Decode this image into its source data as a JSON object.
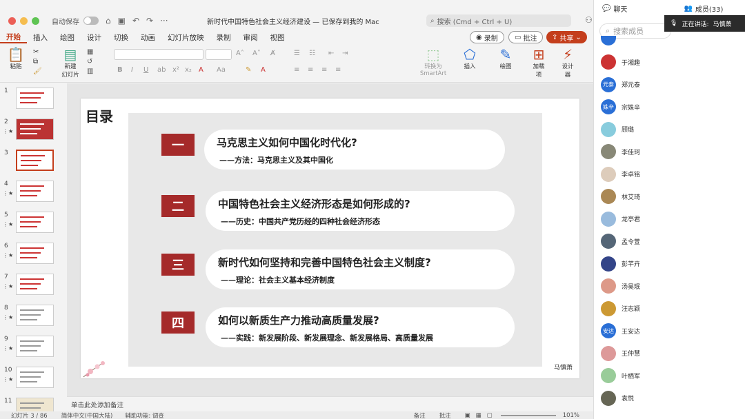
{
  "titlebar": {
    "autosave_label": "自动保存",
    "doc_title": "新时代中国特色社会主义经济建设 — 已保存到我的 Mac",
    "search_placeholder": "搜索 (Cmd + Ctrl + U)"
  },
  "menu": [
    "开始",
    "插入",
    "绘图",
    "设计",
    "切换",
    "动画",
    "幻灯片放映",
    "录制",
    "审阅",
    "视图"
  ],
  "actions": {
    "record": "录制",
    "comment": "批注",
    "share": "共享"
  },
  "ribbon": {
    "paste": "粘贴",
    "new_slide": "新建\n幻灯片",
    "smartart": "转换为\nSmartArt",
    "insert": "插入",
    "draw": "绘图",
    "addins": "加载\n项",
    "designer": "设计\n器"
  },
  "thumbnails": [
    "1",
    "2",
    "3",
    "4",
    "5",
    "6",
    "7",
    "8",
    "9",
    "10",
    "11"
  ],
  "slide": {
    "title": "目录",
    "items": [
      {
        "num": "一",
        "question": "马克思主义如何中国化时代化?",
        "sub": "——方法：马克思主义及其中国化"
      },
      {
        "num": "二",
        "question": "中国特色社会主义经济形态是如何形成的?",
        "sub": "——历史：中国共产党历经的四种社会经济形态"
      },
      {
        "num": "三",
        "question": "新时代如何坚持和完善中国特色社会主义制度?",
        "sub": "——理论：社会主义基本经济制度"
      },
      {
        "num": "四",
        "question": "如何以新质生产力推动高质量发展?",
        "sub": "——实践：新发展阶段、新发展理念、新发展格局、高质量发展"
      }
    ],
    "signature": "马慎萧"
  },
  "notes_placeholder": "单击此处添加备注",
  "status": {
    "slide_info": "幻灯片 3 / 86",
    "language": "简体中文(中国大陆)",
    "accessibility": "辅助功能: 调查",
    "notes": "备注",
    "comments": "批注",
    "zoom": "101%"
  },
  "meeting": {
    "chat_tab": "聊天",
    "members_tab": "成员(33)",
    "speaking_label": "正在讲话:",
    "speaker": "马慎萧",
    "search_placeholder": "搜索成员",
    "members": [
      {
        "name": "于湘趣",
        "avatar": "",
        "color": "#c33"
      },
      {
        "name": "郑元泰",
        "avatar": "元泰",
        "color": "#2a6fd6"
      },
      {
        "name": "宗姝辛",
        "avatar": "姝辛",
        "color": "#2a6fd6"
      },
      {
        "name": "顾璐",
        "avatar": "",
        "color": "#8cd"
      },
      {
        "name": "李佳珂",
        "avatar": "",
        "color": "#887"
      },
      {
        "name": "李卓铭",
        "avatar": "",
        "color": "#dcb"
      },
      {
        "name": "林艾琦",
        "avatar": "",
        "color": "#a85"
      },
      {
        "name": "龙亭君",
        "avatar": "",
        "color": "#9bd"
      },
      {
        "name": "孟令萱",
        "avatar": "",
        "color": "#567"
      },
      {
        "name": "彭芊卉",
        "avatar": "",
        "color": "#348"
      },
      {
        "name": "汤昊珉",
        "avatar": "",
        "color": "#d98"
      },
      {
        "name": "汪志颖",
        "avatar": "",
        "color": "#c93"
      },
      {
        "name": "王安达",
        "avatar": "安达",
        "color": "#2a6fd6"
      },
      {
        "name": "王仲慧",
        "avatar": "",
        "color": "#d99"
      },
      {
        "name": "叶栖军",
        "avatar": "",
        "color": "#9c9"
      },
      {
        "name": "袁悦",
        "avatar": "",
        "color": "#665"
      }
    ]
  }
}
